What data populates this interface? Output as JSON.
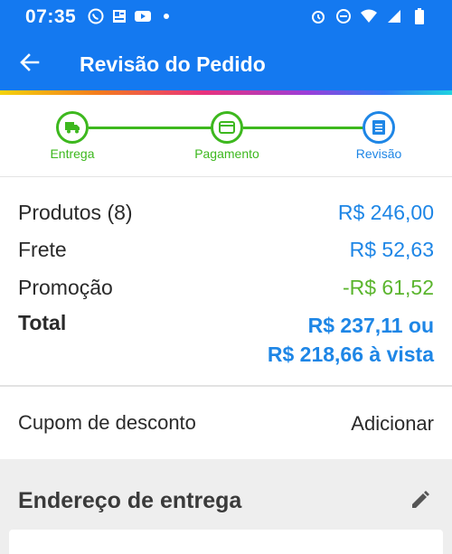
{
  "status_bar": {
    "time": "07:35",
    "left_icons": [
      "whatsapp-icon",
      "news-icon",
      "youtube-icon",
      "dot-icon"
    ],
    "right_icons": [
      "alarm-icon",
      "dnd-icon",
      "wifi-icon",
      "signal-icon",
      "battery-icon"
    ]
  },
  "app_bar": {
    "title": "Revisão do Pedido",
    "back_icon": "arrow-left-icon",
    "color": "#1479f0"
  },
  "stepper": {
    "steps": [
      {
        "label": "Entrega",
        "icon": "truck-icon",
        "state": "done",
        "color": "#3db81e"
      },
      {
        "label": "Pagamento",
        "icon": "card-icon",
        "state": "done",
        "color": "#3db81e"
      },
      {
        "label": "Revisão",
        "icon": "list-icon",
        "state": "current",
        "color": "#1e86e6"
      }
    ]
  },
  "summary": {
    "products_label": "Produtos (8)",
    "products_value": "R$ 246,00",
    "shipping_label": "Frete",
    "shipping_value": "R$ 52,63",
    "promo_label": "Promoção",
    "promo_value": "-R$ 61,52",
    "total_label": "Total",
    "total_value_line1": "R$ 237,11 ou",
    "total_value_line2": "R$ 218,66 à vista",
    "colors": {
      "value": "#1e86e6",
      "promo": "#5bb52e"
    }
  },
  "coupon": {
    "label": "Cupom de desconto",
    "action": "Adicionar"
  },
  "address": {
    "title": "Endereço de entrega",
    "edit_icon": "pencil-icon"
  }
}
